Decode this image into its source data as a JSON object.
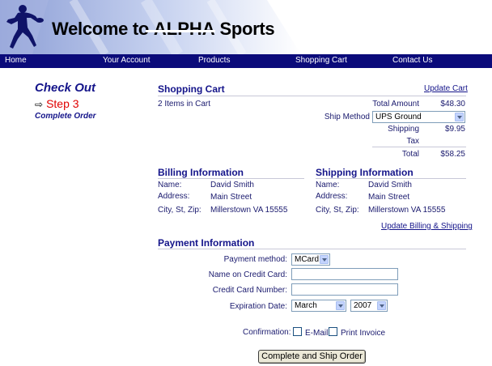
{
  "header": {
    "title_prefix": "Welcome to ",
    "title_brand": "ALPHA",
    "title_suffix": " Sports"
  },
  "nav": [
    {
      "label": "Home"
    },
    {
      "label": "Your Account"
    },
    {
      "label": "Products"
    },
    {
      "label": "Shopping Cart"
    },
    {
      "label": "Contact Us"
    }
  ],
  "sidebar": {
    "title": "Check Out",
    "step": "Step 3",
    "step_desc": "Complete Order"
  },
  "cart": {
    "heading": "Shopping Cart",
    "update_link": "Update Cart",
    "items_text": "2 Items in Cart",
    "total_amount_label": "Total Amount",
    "total_amount_value": "$48.30",
    "ship_method_label": "Ship Method",
    "ship_method_value": "UPS Ground",
    "shipping_label": "Shipping",
    "shipping_value": "$9.95",
    "tax_label": "Tax",
    "tax_value": "",
    "total_label": "Total",
    "total_value": "$58.25"
  },
  "billing": {
    "heading": "Billing Information",
    "name_label": "Name:",
    "name_value": "David Smith",
    "address_label": "Address:",
    "address_value": "Main Street",
    "csz_label": "City, St, Zip:",
    "csz_value": "Millerstown VA 15555"
  },
  "shipping": {
    "heading": "Shipping Information",
    "name_label": "Name:",
    "name_value": "David Smith",
    "address_label": "Address:",
    "address_value": "Main Street",
    "csz_label": "City, St, Zip:",
    "csz_value": "Millerstown VA 15555",
    "update_link": "Update Billing & Shipping"
  },
  "payment": {
    "heading": "Payment Information",
    "method_label": "Payment method:",
    "method_value": "MCard",
    "name_label": "Name on Credit Card:",
    "name_value": "",
    "number_label": "Credit Card Number:",
    "number_value": "",
    "exp_label": "Expiration Date:",
    "exp_month": "March",
    "exp_year": "2007",
    "confirm_label": "Confirmation:",
    "email_label": "E-Mail",
    "print_label": "Print Invoice",
    "submit_label": "Complete and Ship Order"
  },
  "colors": {
    "nav_bg": "#0b0b7a",
    "heading": "#14148a",
    "step": "#e00000"
  }
}
